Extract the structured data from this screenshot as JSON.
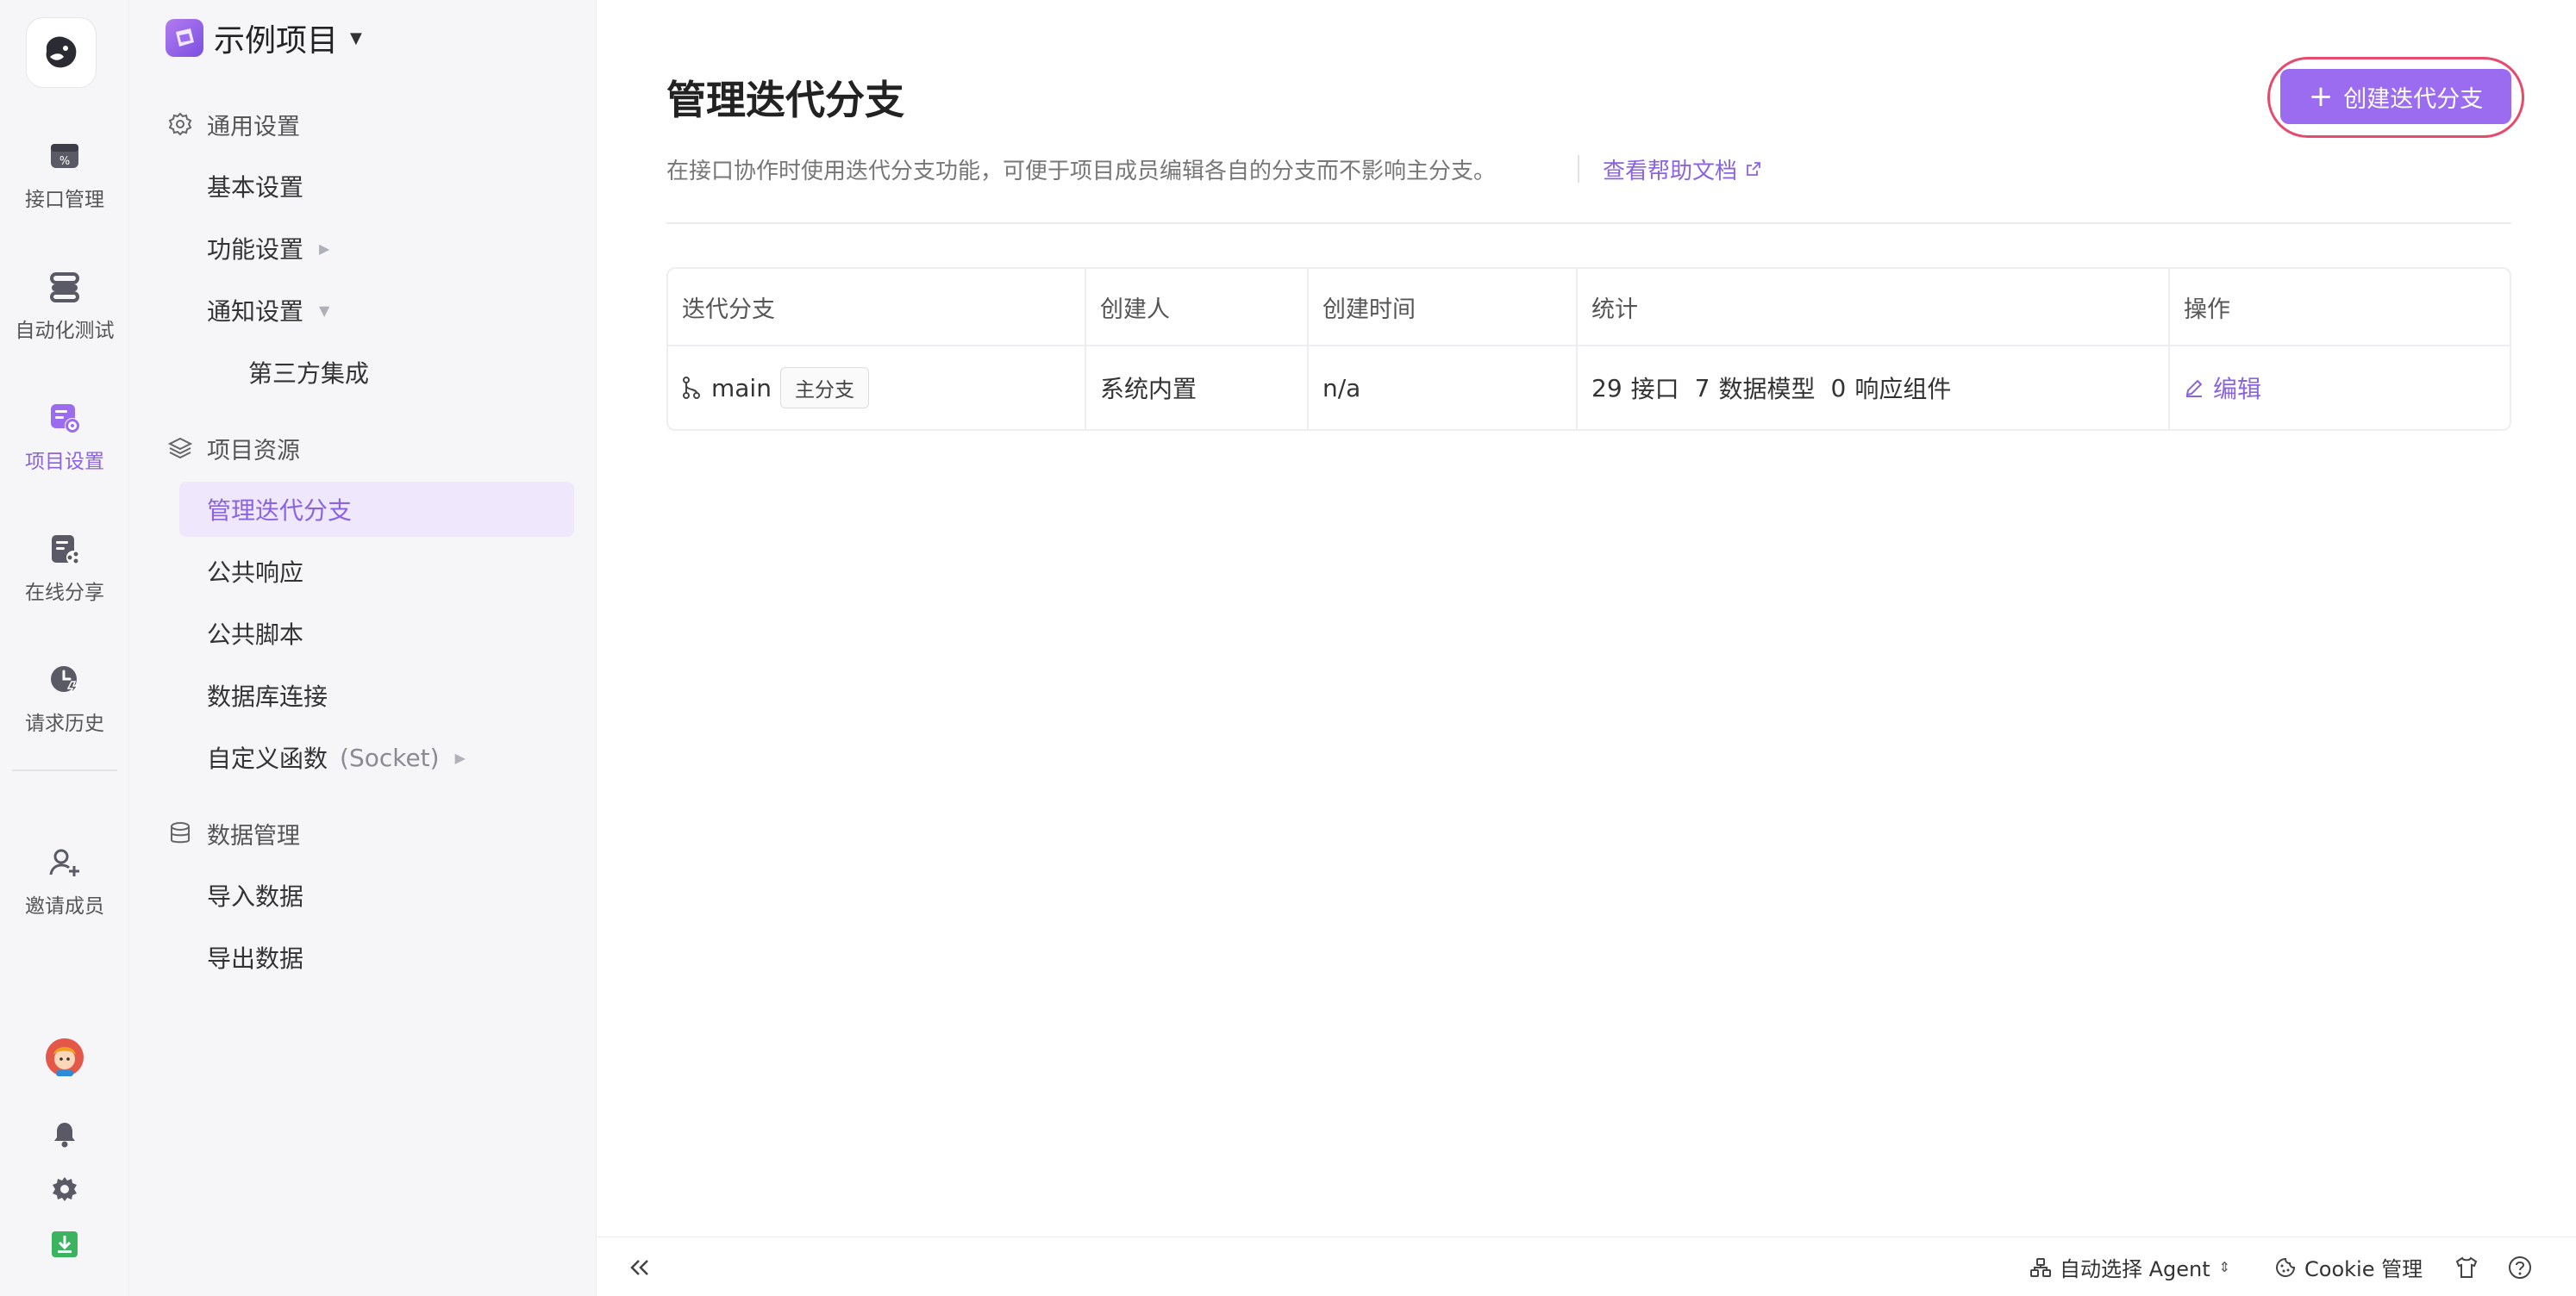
{
  "rail": {
    "items": [
      {
        "label": "接口管理",
        "icon": "api-management-icon"
      },
      {
        "label": "自动化测试",
        "icon": "automation-test-icon"
      },
      {
        "label": "项目设置",
        "icon": "project-settings-icon",
        "active": true
      },
      {
        "label": "在线分享",
        "icon": "online-share-icon"
      },
      {
        "label": "请求历史",
        "icon": "request-history-icon"
      },
      {
        "label": "邀请成员",
        "icon": "invite-member-icon"
      }
    ]
  },
  "project": {
    "name": "示例项目"
  },
  "sidebar": {
    "general_section": "通用设置",
    "basic_settings": "基本设置",
    "feature_settings": "功能设置",
    "notification_settings": "通知设置",
    "third_party": "第三方集成",
    "resources_section": "项目资源",
    "manage_branches": "管理迭代分支",
    "common_response": "公共响应",
    "common_script": "公共脚本",
    "db_connection": "数据库连接",
    "custom_function": "自定义函数",
    "custom_function_suffix": "(Socket)",
    "data_section": "数据管理",
    "import_data": "导入数据",
    "export_data": "导出数据"
  },
  "main": {
    "title": "管理迭代分支",
    "description": "在接口协作时使用迭代分支功能，可便于项目成员编辑各自的分支而不影响主分支。",
    "help_link": "查看帮助文档",
    "create_button": "创建迭代分支"
  },
  "table": {
    "headers": [
      "迭代分支",
      "创建人",
      "创建时间",
      "统计",
      "操作"
    ],
    "rows": [
      {
        "branch": "main",
        "tag": "主分支",
        "creator": "系统内置",
        "created_at": "n/a",
        "stats": {
          "api_count": "29",
          "api_label": "接口",
          "model_count": "7",
          "model_label": "数据模型",
          "component_count": "0",
          "component_label": "响应组件"
        },
        "action": "编辑"
      }
    ]
  },
  "footer": {
    "agent_label": "自动选择 Agent",
    "cookie_label": "Cookie 管理"
  },
  "colors": {
    "accent": "#9b6cf0",
    "accent_text": "#8a63e0",
    "highlight_ring": "#e64a6e",
    "download_green": "#3cb35f"
  }
}
